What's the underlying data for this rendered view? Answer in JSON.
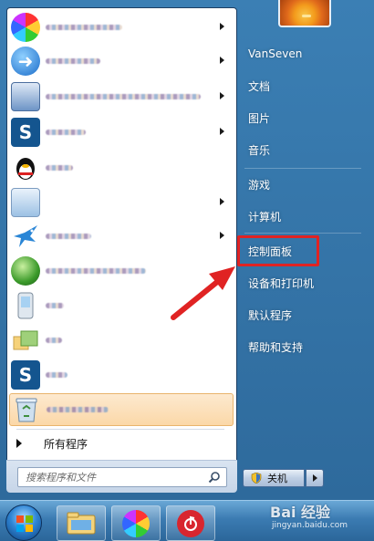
{
  "start_menu": {
    "user": {
      "name": "VanSeven"
    },
    "right_items": [
      {
        "label": "文档"
      },
      {
        "label": "图片"
      },
      {
        "label": "音乐"
      },
      {
        "label": "游戏"
      },
      {
        "label": "计算机"
      },
      {
        "label": "控制面板"
      },
      {
        "label": "设备和打印机"
      },
      {
        "label": "默认程序"
      },
      {
        "label": "帮助和支持"
      }
    ],
    "programs": [
      {
        "icon": "colorful-ball-icon",
        "has_submenu": true
      },
      {
        "icon": "blue-arrow-icon",
        "has_submenu": true
      },
      {
        "icon": "monitor-document-icon",
        "has_submenu": true
      },
      {
        "icon": "s-logo-icon",
        "has_submenu": true
      },
      {
        "icon": "qq-penguin-icon",
        "has_submenu": false
      },
      {
        "icon": "document-icon",
        "has_submenu": true
      },
      {
        "icon": "blue-bird-icon",
        "has_submenu": true
      },
      {
        "icon": "windows-media-icon",
        "has_submenu": false
      },
      {
        "icon": "mobile-phone-icon",
        "has_submenu": false
      },
      {
        "icon": "photo-gallery-icon",
        "has_submenu": false
      },
      {
        "icon": "s-logo-icon",
        "has_submenu": false
      },
      {
        "icon": "recycle-bin-icon",
        "has_submenu": false,
        "selected": true
      }
    ],
    "all_programs_label": "所有程序",
    "search": {
      "placeholder": "搜索程序和文件"
    },
    "shutdown_label": "关机",
    "highlighted_item": "控制面板"
  },
  "taskbar": {
    "items": [
      {
        "icon": "start-orb-icon"
      },
      {
        "icon": "file-explorer-icon"
      },
      {
        "icon": "colorful-ball-icon"
      },
      {
        "icon": "netease-music-icon"
      }
    ]
  },
  "watermark": {
    "brand": "Bai 经验",
    "url": "jingyan.baidu.com"
  },
  "colors": {
    "annotation_red": "#e02323",
    "menu_blue": "#2e6a9c",
    "selected_item": "#fbd8a8"
  }
}
